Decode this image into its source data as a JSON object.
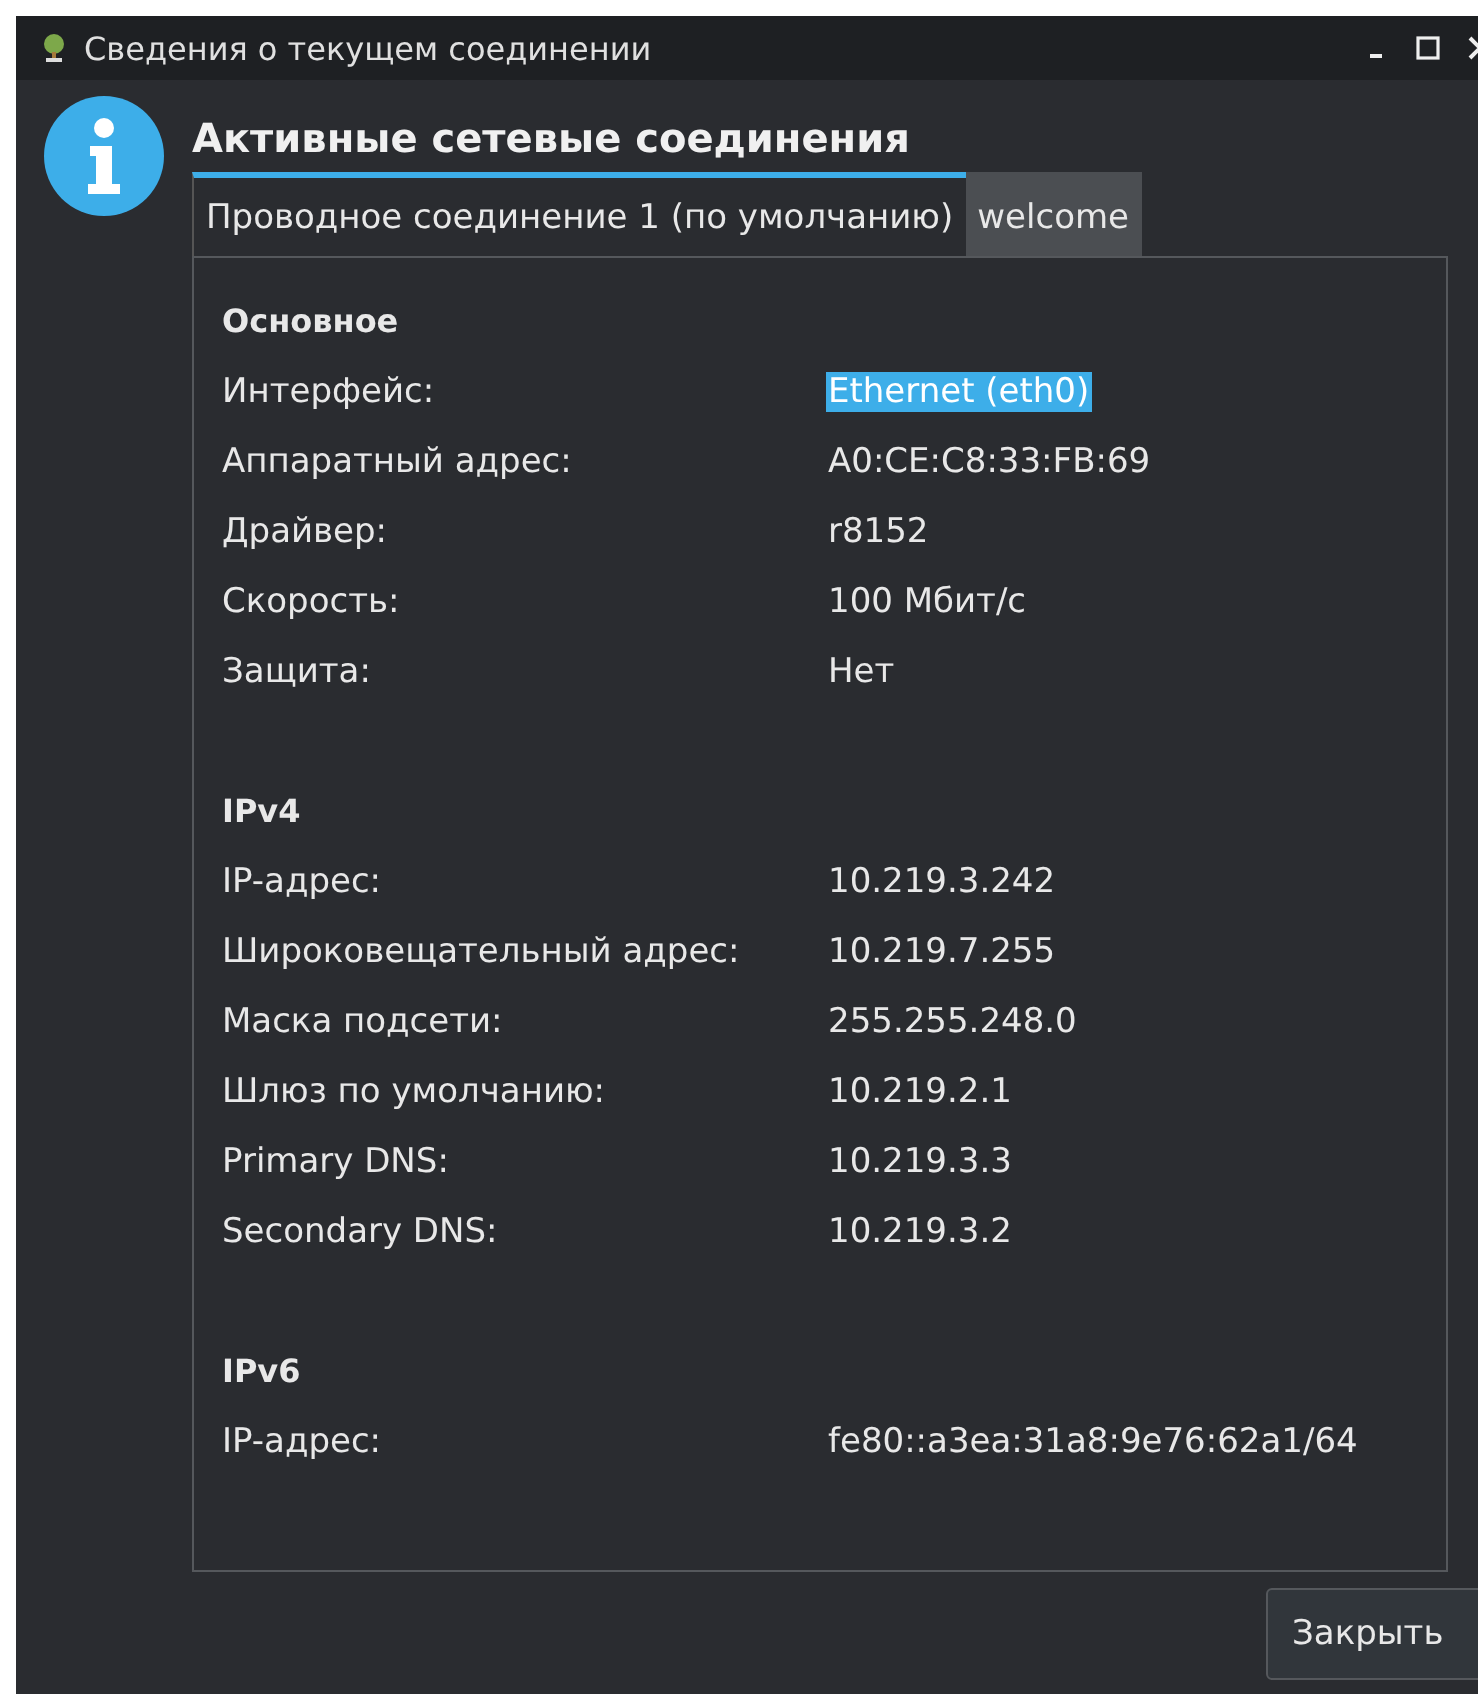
{
  "window": {
    "title": "Сведения о текущем соединении"
  },
  "heading": "Активные сетевые соединения",
  "tabs": [
    {
      "label": "Проводное соединение 1 (по умолчанию)",
      "selected": true
    },
    {
      "label": "welcome",
      "selected": false
    }
  ],
  "sections": [
    {
      "title": "Основное",
      "rows": [
        {
          "label": "Интерфейс:",
          "value": "Ethernet (eth0)",
          "selected": true
        },
        {
          "label": "Аппаратный адрес:",
          "value": "A0:CE:C8:33:FB:69",
          "selected": false
        },
        {
          "label": "Драйвер:",
          "value": "r8152",
          "selected": false
        },
        {
          "label": "Скорость:",
          "value": "100 Мбит/с",
          "selected": false
        },
        {
          "label": "Защита:",
          "value": "Нет",
          "selected": false
        }
      ]
    },
    {
      "title": "IPv4",
      "rows": [
        {
          "label": "IP-адрес:",
          "value": "10.219.3.242",
          "selected": false
        },
        {
          "label": "Широковещательный адрес:",
          "value": "10.219.7.255",
          "selected": false
        },
        {
          "label": "Маска подсети:",
          "value": "255.255.248.0",
          "selected": false
        },
        {
          "label": "Шлюз по умолчанию:",
          "value": "10.219.2.1",
          "selected": false
        },
        {
          "label": "Primary DNS:",
          "value": "10.219.3.3",
          "selected": false
        },
        {
          "label": "Secondary DNS:",
          "value": "10.219.3.2",
          "selected": false
        }
      ]
    },
    {
      "title": "IPv6",
      "rows": [
        {
          "label": "IP-адрес:",
          "value": "fe80::a3ea:31a8:9e76:62a1/64",
          "selected": false
        }
      ]
    }
  ],
  "buttons": [
    "Закрыть"
  ]
}
